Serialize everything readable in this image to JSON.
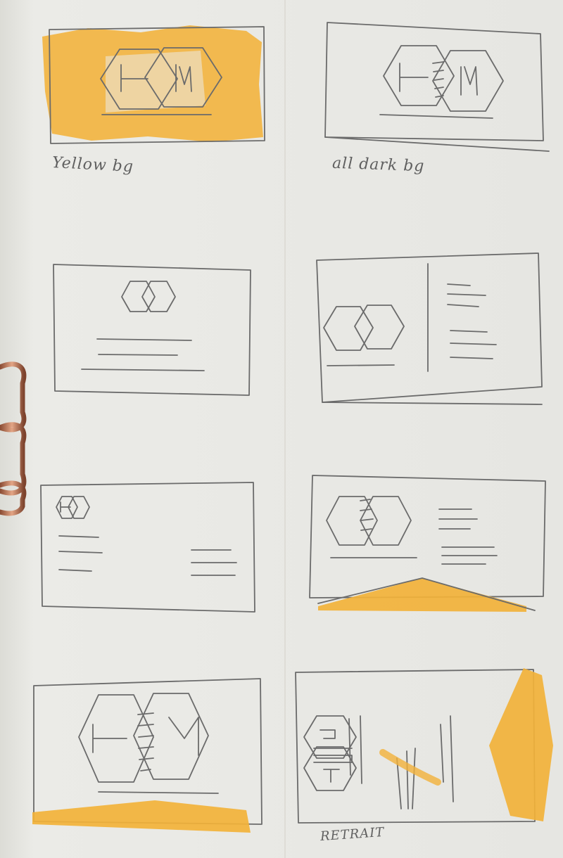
{
  "captions": {
    "yellow": "Yellow bg",
    "dark": "all dark bg",
    "bottom": "RETRAIT"
  },
  "colors": {
    "paper": "#ebebe7",
    "pencil": "#6b6b6b",
    "marker": "#f2b23a",
    "binder_ring": "#c97a59"
  }
}
